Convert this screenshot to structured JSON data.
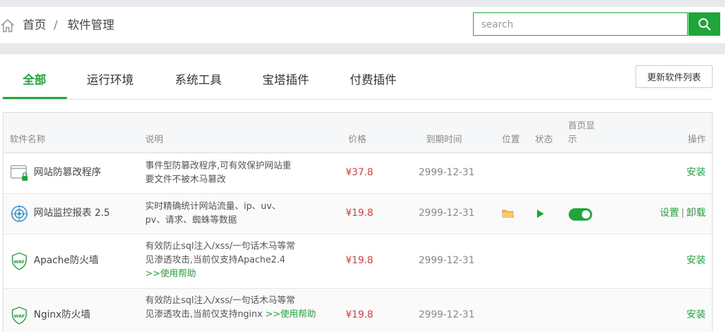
{
  "header": {
    "breadcrumb": [
      "首页",
      "/",
      "软件管理"
    ],
    "search_placeholder": "search"
  },
  "tabs": [
    {
      "label": "全部",
      "active": true
    },
    {
      "label": "运行环境",
      "active": false
    },
    {
      "label": "系统工具",
      "active": false
    },
    {
      "label": "宝塔插件",
      "active": false
    },
    {
      "label": "付费插件",
      "active": false
    }
  ],
  "refresh_label": "更新软件列表",
  "columns": {
    "name": "软件名称",
    "desc": "说明",
    "price": "价格",
    "expire": "到期时间",
    "location": "位置",
    "status": "状态",
    "homepage_line1": "首页显",
    "homepage_line2": "示",
    "action": "操作"
  },
  "rows": [
    {
      "icon": "tamper-proof-icon",
      "name": "网站防篡改程序",
      "desc_lines": [
        "事件型防篡改程序,可有效保护网站重",
        "要文件不被木马篡改"
      ],
      "help": "",
      "price": "¥37.8",
      "expire": "2999-12-31",
      "actions": [
        "安装"
      ]
    },
    {
      "icon": "monitor-report-icon",
      "name": "网站监控报表 2.5",
      "desc_lines": [
        "实时精确统计网站流量、ip、uv、",
        "pv、请求、蜘蛛等数据"
      ],
      "help": "",
      "price": "¥19.8",
      "expire": "2999-12-31",
      "actions": [
        "设置",
        "卸载"
      ],
      "installed": true
    },
    {
      "icon": "waf-shield-icon",
      "name": "Apache防火墙",
      "desc_lines": [
        "有效防止sql注入/xss/一句话木马等常",
        "见渗透攻击,当前仅支持Apache2.4"
      ],
      "help": ">>使用帮助",
      "price": "¥19.8",
      "expire": "2999-12-31",
      "actions": [
        "安装"
      ]
    },
    {
      "icon": "waf-shield-icon",
      "name": "Nginx防火墙",
      "desc_lines": [
        "有效防止sql注入/xss/一句话木马等常",
        "见渗透攻击,当前仅支持nginx "
      ],
      "help": ">>使用帮助",
      "price": "¥19.8",
      "expire": "2999-12-31",
      "actions": [
        "安装"
      ]
    }
  ],
  "colors": {
    "accent": "#20a53a",
    "price": "#e4393c",
    "folder": "#f0b340"
  }
}
